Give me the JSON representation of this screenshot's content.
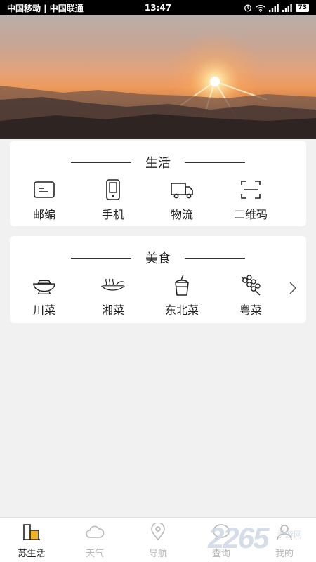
{
  "status_bar": {
    "carriers": "中国移动 | 中国联通",
    "time": "13:47",
    "battery": "73"
  },
  "banner": {
    "image": "sunset-mountains"
  },
  "life_section": {
    "title": "生活",
    "items": [
      {
        "label": "邮编",
        "icon": "postcode-icon"
      },
      {
        "label": "手机",
        "icon": "phone-icon"
      },
      {
        "label": "物流",
        "icon": "truck-icon"
      },
      {
        "label": "二维码",
        "icon": "qr-scan-icon"
      }
    ]
  },
  "food_section": {
    "title": "美食",
    "items": [
      {
        "label": "川菜",
        "icon": "hotpot-icon"
      },
      {
        "label": "湘菜",
        "icon": "dish-icon"
      },
      {
        "label": "东北菜",
        "icon": "drink-icon"
      },
      {
        "label": "粤菜",
        "icon": "skewer-icon"
      }
    ]
  },
  "tabbar": {
    "tabs": [
      {
        "label": "苏生活",
        "icon": "building-icon",
        "active": true
      },
      {
        "label": "天气",
        "icon": "cloud-icon",
        "active": false
      },
      {
        "label": "导航",
        "icon": "location-pin-icon",
        "active": false
      },
      {
        "label": "查询",
        "icon": "search-chat-icon",
        "active": false
      },
      {
        "label": "我的",
        "icon": "user-icon",
        "active": false
      }
    ]
  },
  "watermark": {
    "number": "2265",
    "site": "手游网"
  },
  "colors": {
    "active_tab": "#222222",
    "inactive_tab": "#b8b8b8",
    "accent": "#f0b429",
    "background": "#f1f1f1"
  }
}
